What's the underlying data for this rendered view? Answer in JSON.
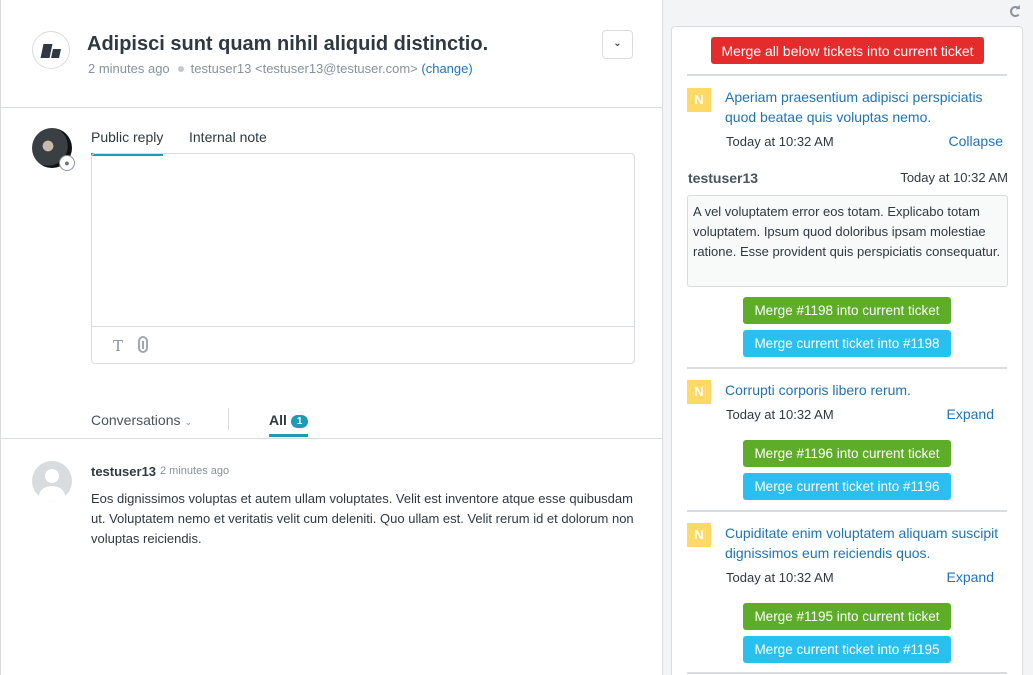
{
  "header": {
    "title": "Adipisci sunt quam nihil aliquid distinctio.",
    "time": "2 minutes ago",
    "requester": "testuser13 <testuser13@testuser.com>",
    "change_label": "(change)"
  },
  "composer": {
    "tab_public": "Public reply",
    "tab_internal": "Internal note",
    "text_tool": "T"
  },
  "conversations": {
    "filter_label": "Conversations",
    "tab_all": "All",
    "count": "1"
  },
  "comment": {
    "author": "testuser13",
    "time": "2 minutes ago",
    "body": "Eos dignissimos voluptas et autem ullam voluptates. Velit est inventore atque esse quibusdam ut. Voluptatem nemo et veritatis velit cum deleniti. Quo ullam est. Velit rerum id et dolorum non voluptas reiciendis."
  },
  "merge": {
    "merge_all_label": "Merge all below tickets into current ticket",
    "tickets": [
      {
        "status": "N",
        "subject": "Aperiam praesentium adipisci perspiciatis quod beatae quis voluptas nemo.",
        "time": "Today at 10:32 AM",
        "toggle": "Collapse",
        "requester": "testuser13",
        "requester_time": "Today at 10:32 AM",
        "description": "A vel voluptatem error eos totam. Explicabo totam voluptatem. Ipsum quod doloribus ipsam molestiae ratione. Esse provident quis perspiciatis consequatur.",
        "merge_into_current": "Merge #1198 into current ticket",
        "merge_current_into": "Merge current ticket into #1198"
      },
      {
        "status": "N",
        "subject": "Corrupti corporis libero rerum.",
        "time": "Today at 10:32 AM",
        "toggle": "Expand",
        "merge_into_current": "Merge #1196 into current ticket",
        "merge_current_into": "Merge current ticket into #1196"
      },
      {
        "status": "N",
        "subject": "Cupiditate enim voluptatem aliquam suscipit dignissimos eum reiciendis quos.",
        "time": "Today at 10:32 AM",
        "toggle": "Expand",
        "merge_into_current": "Merge #1195 into current ticket",
        "merge_current_into": "Merge current ticket into #1195"
      }
    ]
  },
  "colors": {
    "accent": "#1f9ab4",
    "link": "#1f73b7",
    "danger": "#e42c2c",
    "success": "#5ead29",
    "info": "#29c0f0",
    "status_new": "#ffd966"
  }
}
